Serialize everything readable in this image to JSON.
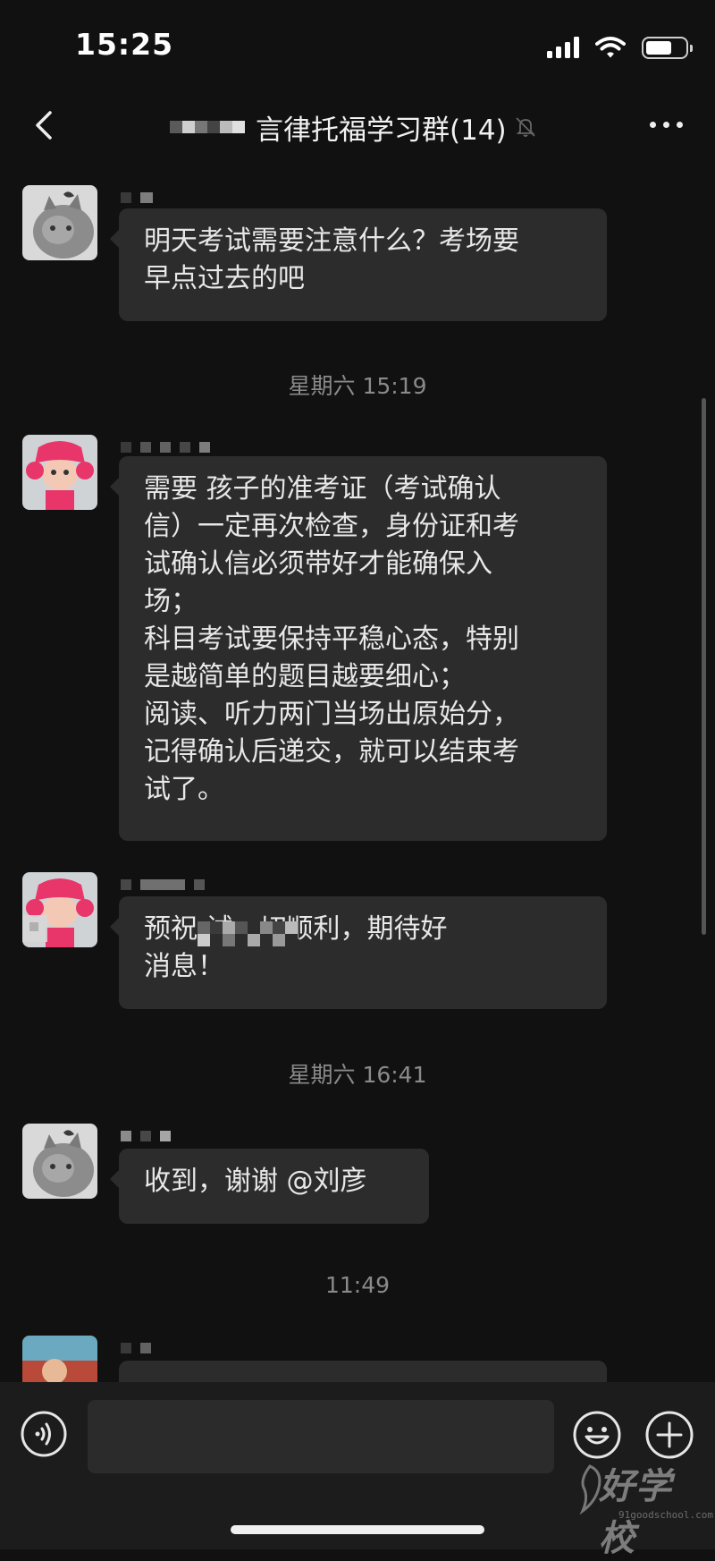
{
  "status_bar": {
    "time": "15:25"
  },
  "nav": {
    "title": "言律托福学习群(14)"
  },
  "messages": [
    {
      "text": "明天考试需要注意什么？考场要\n早点过去的吧"
    },
    {
      "text": "需要 孩子的准考证（考试确认\n信）一定再次检查，身份证和考\n试确认信必须带好才能确保入\n场；\n科目考试要保持平稳心态，特别\n是越简单的题目越要细心；\n阅读、听力两门当场出原始分，\n记得确认后递交，就可以结束考\n试了。"
    },
    {
      "text": "预祝       试一切顺利，期待好\n消息！"
    },
    {
      "text": "收到，谢谢 @刘彦"
    },
    {
      "text": ""
    }
  ],
  "timestamps": [
    "星期六 15:19",
    "星期六 16:41",
    "11:49"
  ],
  "input": {
    "value": "",
    "placeholder": ""
  },
  "watermark": {
    "brand": "好学校",
    "url": "91goodschool.com"
  },
  "colors": {
    "background": "#111111",
    "bubble": "#2c2c2c",
    "timestamp": "#8a8a8a"
  }
}
